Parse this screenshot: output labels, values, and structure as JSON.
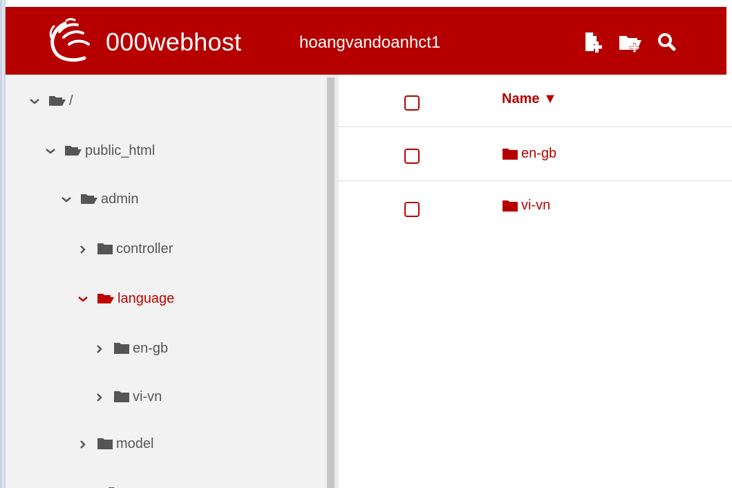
{
  "header": {
    "brand": "000webhost",
    "username": "hoangvandoanhct1",
    "icons": [
      "new-file-icon",
      "new-folder-icon",
      "search-icon"
    ],
    "background_color": "#b60000"
  },
  "sidebar": {
    "items": [
      {
        "label": "/",
        "expanded": true,
        "active": false
      },
      {
        "label": "public_html",
        "expanded": true,
        "active": false
      },
      {
        "label": "admin",
        "expanded": true,
        "active": false
      },
      {
        "label": "controller",
        "expanded": false,
        "active": false
      },
      {
        "label": "language",
        "expanded": true,
        "active": true
      },
      {
        "label": "en-gb",
        "expanded": false,
        "active": false
      },
      {
        "label": "vi-vn",
        "expanded": false,
        "active": false
      },
      {
        "label": "model",
        "expanded": false,
        "active": false
      }
    ]
  },
  "main": {
    "name_header": "Name ▼",
    "files": [
      {
        "name": "en-gb",
        "type": "folder"
      },
      {
        "name": "vi-vn",
        "type": "folder"
      }
    ]
  },
  "colors": {
    "accent": "#b60000",
    "tree_text": "#555555",
    "sidebar_bg": "#f2f2f2"
  }
}
